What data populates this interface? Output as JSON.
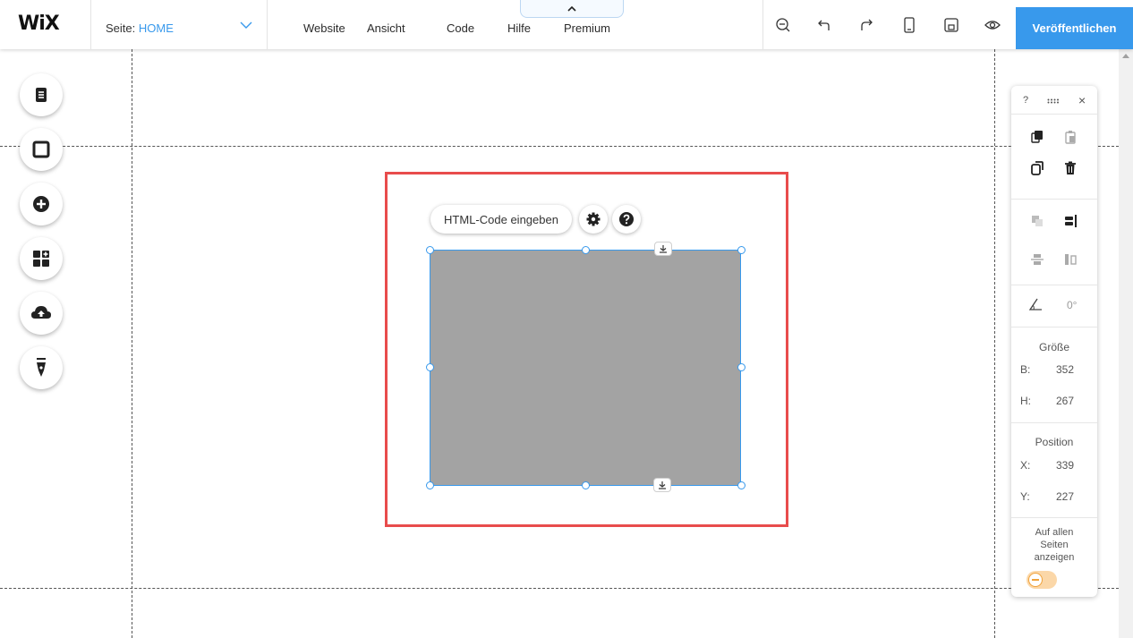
{
  "app": {
    "logo": "WiX"
  },
  "page_selector": {
    "label": "Seite:",
    "value": "HOME"
  },
  "menu": [
    "Website",
    "Ansicht",
    "Code",
    "Hilfe",
    "Premium"
  ],
  "toolbar": {
    "tools": [
      "zoom-out-icon",
      "undo-icon",
      "redo-icon",
      "mobile-icon",
      "save-icon",
      "preview-icon"
    ],
    "publish_label": "Veröffentlichen"
  },
  "left_panel": {
    "tools": [
      "pages-icon",
      "background-icon",
      "add-icon",
      "app-market-icon",
      "upload-icon",
      "blog-pen-icon"
    ]
  },
  "element": {
    "html_button_label": "HTML-Code eingeben",
    "settings_icon": "gear-icon",
    "help_icon": "help-icon"
  },
  "inspector": {
    "help": "?",
    "close": "×",
    "rotation": "0°",
    "size_title": "Größe",
    "width_label": "B:",
    "width_value": "352",
    "height_label": "H:",
    "height_value": "267",
    "position_title": "Position",
    "x_label": "X:",
    "x_value": "339",
    "y_label": "Y:",
    "y_value": "227",
    "show_all_pages": "Auf allen Seiten anzeigen",
    "show_all_pages_on": false
  },
  "colors": {
    "accent": "#3899ec",
    "highlight": "#e84c4c",
    "element_fill": "#a3a3a3",
    "toggle": "#fbd7a8"
  }
}
